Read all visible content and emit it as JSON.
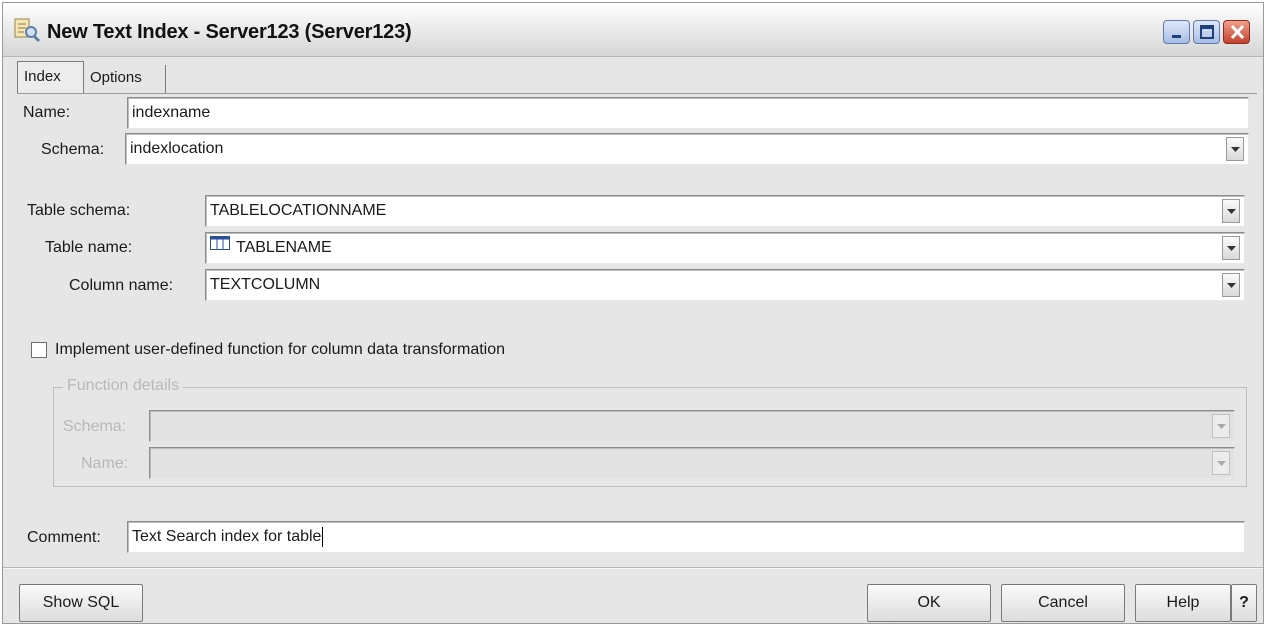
{
  "window": {
    "title": "New Text Index - Server123 (Server123)"
  },
  "tabs": [
    {
      "label": "Index"
    },
    {
      "label": "Options"
    }
  ],
  "form": {
    "name_label": "Name:",
    "name_value": "indexname",
    "schema_label": "Schema:",
    "schema_value": "indexlocation",
    "table_schema_label": "Table schema:",
    "table_schema_value": "TABLELOCATIONNAME",
    "table_name_label": "Table name:",
    "table_name_value": "TABLENAME",
    "column_name_label": "Column name:",
    "column_name_value": "TEXTCOLUMN",
    "udf_checkbox_label": "Implement user-defined function for column data transformation",
    "udf_checked": false,
    "function_details": {
      "title": "Function details",
      "schema_label": "Schema:",
      "name_label": "Name:"
    },
    "comment_label": "Comment:",
    "comment_value": "Text Search index for table"
  },
  "buttons": {
    "show_sql": "Show SQL",
    "ok": "OK",
    "cancel": "Cancel",
    "help": "Help",
    "help_question": "?"
  }
}
